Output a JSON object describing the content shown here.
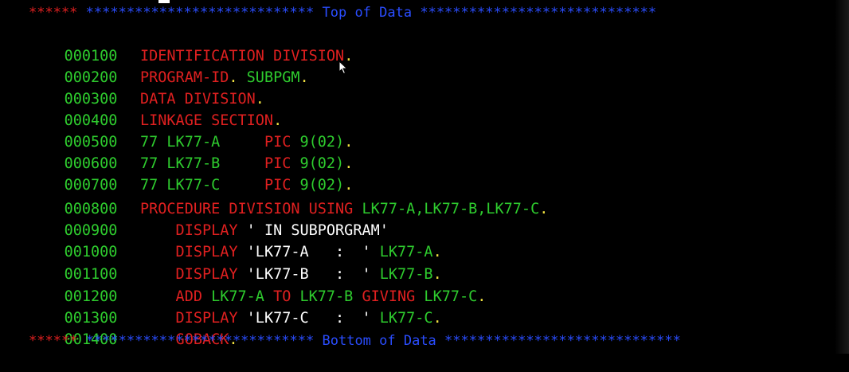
{
  "terminal": {
    "top_marker": {
      "prefix": "******",
      "stars_left": "****************************",
      "label": "Top of Data",
      "stars_right": "*****************************"
    },
    "bottom_marker": {
      "prefix": "******",
      "stars_left": "****************************",
      "label": "Bottom of Data",
      "stars_right": "*****************************"
    },
    "lines": [
      {
        "seq": "000100",
        "t1": "IDENTIFICATION DIVISION",
        "t2": "."
      },
      {
        "seq": "000200",
        "t1": "PROGRAM-ID",
        "t2": ".",
        "t3": " SUBPGM",
        "t4": "."
      },
      {
        "seq": "000300",
        "t1": "DATA DIVISION",
        "t2": "."
      },
      {
        "seq": "000400",
        "t1": "LINKAGE SECTION",
        "t2": "."
      },
      {
        "seq": "000500",
        "t1": "77 LK77-A     ",
        "t2": "PIC",
        "t3": " 9(02)",
        "t4": "."
      },
      {
        "seq": "000600",
        "t1": "77 LK77-B     ",
        "t2": "PIC",
        "t3": " 9(02)",
        "t4": "."
      },
      {
        "seq": "000700",
        "t1": "77 LK77-C     ",
        "t2": "PIC",
        "t3": " 9(02)",
        "t4": "."
      },
      {
        "seq": "000800",
        "t1": "PROCEDURE DIVISION USING",
        "t2": " LK77-A,LK77-B,LK77-C",
        "t3": "."
      },
      {
        "seq": "000900",
        "t1": "    DISPLAY",
        "t2": " ' IN SUBPORGRAM'"
      },
      {
        "seq": "001000",
        "t1": "    DISPLAY",
        "t2": " 'LK77-A   :  '",
        "t3": " LK77-A",
        "t4": "."
      },
      {
        "seq": "001100",
        "t1": "    DISPLAY",
        "t2": " 'LK77-B   :  '",
        "t3": " LK77-B",
        "t4": "."
      },
      {
        "seq": "001200",
        "t1": "    ADD",
        "t2": " LK77-A",
        "t3": " TO",
        "t4": " LK77-B",
        "t5": " GIVING",
        "t6": " LK77-C",
        "t7": "."
      },
      {
        "seq": "001300",
        "t1": "    DISPLAY",
        "t2": " 'LK77-C   :  '",
        "t3": " LK77-C",
        "t4": "."
      },
      {
        "seq": "001400",
        "t1": "    GOBACK",
        "t2": "."
      }
    ]
  }
}
